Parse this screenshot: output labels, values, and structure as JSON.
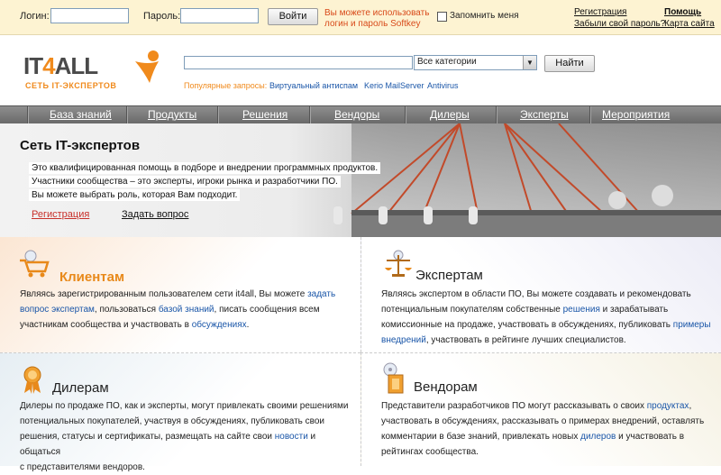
{
  "top": {
    "login_label": "Логин:",
    "password_label": "Пароль:",
    "login_button": "Войти",
    "note": "Вы можете использовать логин и пароль Softkey",
    "remember": "Запомнить меня",
    "register": "Регистрация",
    "forgot": "Забыли свой пароль?",
    "help": "Помощь",
    "sitemap": "Карта сайта"
  },
  "logo": {
    "word_a": "IT",
    "word_b": "4",
    "word_c": "ALL",
    "tagline": "СЕТЬ IT-ЭКСПЕРТОВ"
  },
  "search": {
    "category": "Все категории",
    "button": "Найти",
    "popular_label": "Популярные запросы:",
    "popular": [
      "Виртуальный антиспам",
      "Kerio MailServer",
      "Antivirus"
    ]
  },
  "nav": [
    "База знаний",
    "Продукты",
    "Решения",
    "Вендоры",
    "Дилеры",
    "Эксперты",
    "Мероприятия"
  ],
  "hero": {
    "title": "Сеть IT-экспертов",
    "lines": [
      "Это квалифицированная помощь в подборе и внедрении программных продуктов.",
      "Участники сообщества – это эксперты, игроки рынка и разработчики ПО.",
      "Вы можете выбрать роль, которая Вам подходит."
    ],
    "register": "Регистрация",
    "ask": "Задать вопрос"
  },
  "panels": {
    "clients": {
      "title": "Клиентам",
      "t1": "Являясь зарегистрированным пользователем сети it4all, Вы можете ",
      "l1": "задать",
      "l1b": "вопрос экспертам",
      "t2": ", пользоваться ",
      "l2": "базой знаний",
      "t3": ", писать сообщения всем",
      "t4": "участникам сообщества и участвовать в ",
      "l3": "обсуждениях",
      "t5": "."
    },
    "experts": {
      "title": "Экспертам",
      "t1": "Являясь экспертом в области ПО, Вы можете создавать и рекомендовать",
      "t2": "потенциальным покупателям собственные ",
      "l1": "решения",
      "t3": " и зарабатывать",
      "t4": "комиссионные на продаже, участвовать в обсуждениях, публиковать ",
      "l2": "примеры",
      "l2b": "внедрений",
      "t5": ", участвовать в рейтинге лучших специалистов."
    },
    "dealers": {
      "title": "Дилерам",
      "t1": "Дилеры по продаже ПО, как и эксперты, могут привлекать своими решениями",
      "t2": "потенциальных покупателей, участвуя в обсуждениях, публиковать свои",
      "t3": "решения, статусы и сертификаты, размещать на сайте свои ",
      "l1": "новости",
      "t4": " и общаться",
      "t5": "с представителями вендоров."
    },
    "vendors": {
      "title": "Вендорам",
      "t1": "Представители разработчиков ПО могут рассказывать о своих ",
      "l1": "продуктах",
      "t2": ",",
      "t3": "участвовать в обсуждениях, рассказывать о примерах внедрений, оставлять",
      "t4": "комментарии в базе знаний, привлекать новых ",
      "l2": "дилеров",
      "t5": " и участвовать в",
      "t6": "рейтингах сообщества."
    }
  },
  "colors": {
    "accent": "#f08a1c",
    "link": "#1a56a8",
    "note": "#d84a1a",
    "nav": "#7a7a7a"
  }
}
